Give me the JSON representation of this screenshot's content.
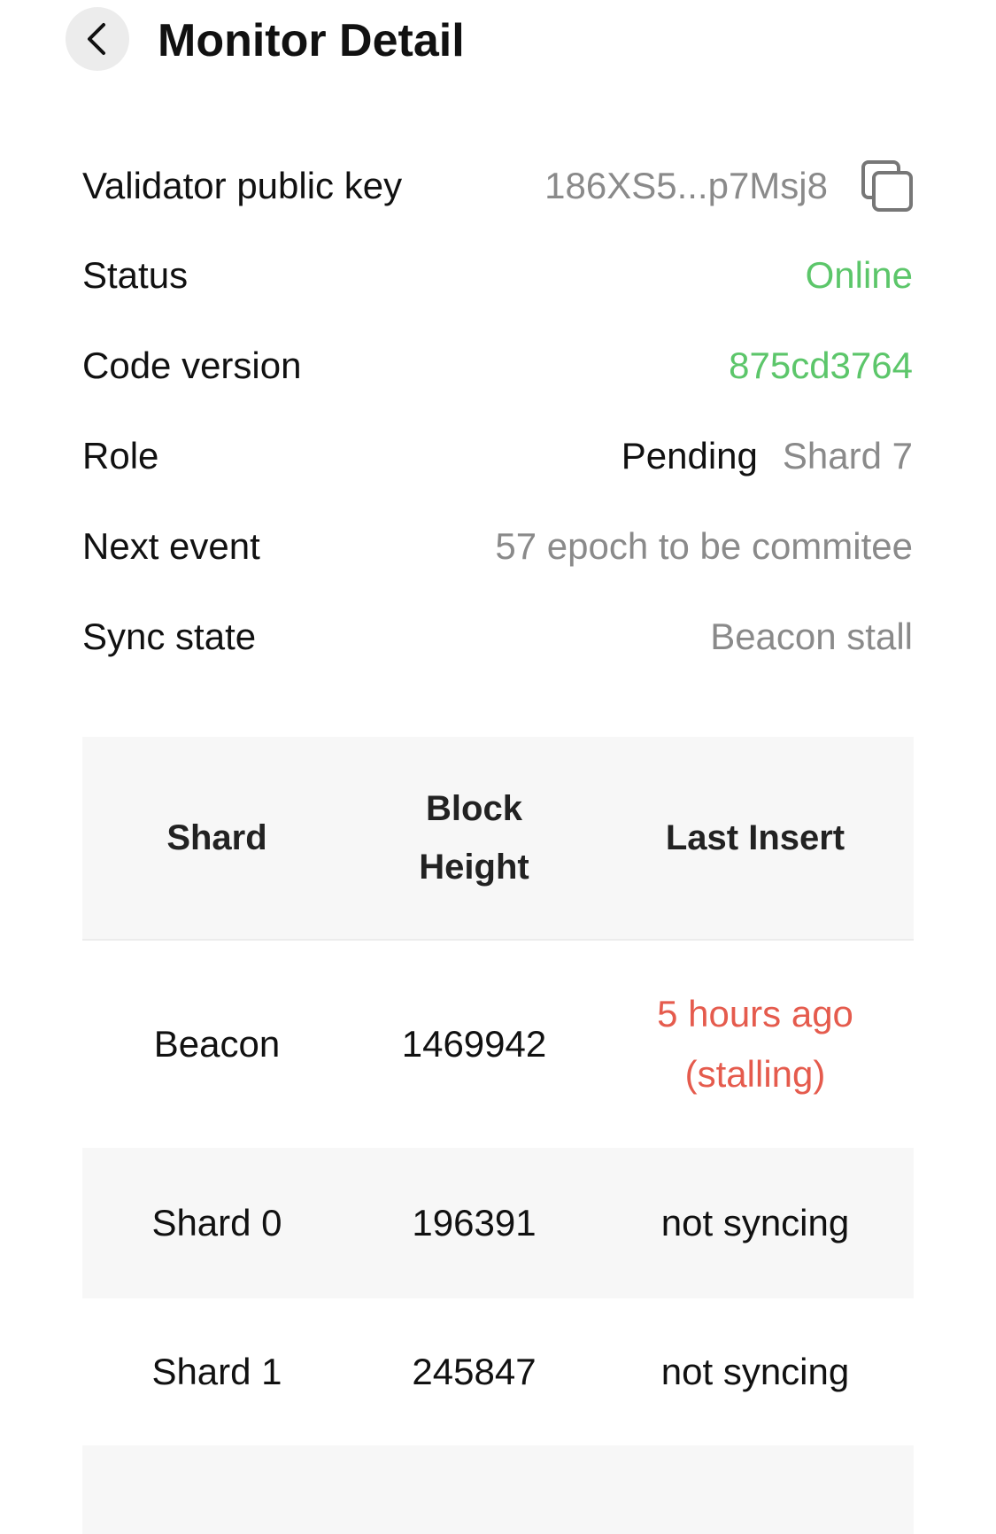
{
  "header": {
    "title": "Monitor Detail"
  },
  "info": {
    "public_key_label": "Validator public key",
    "public_key_value": "186XS5...p7Msj8",
    "status_label": "Status",
    "status_value": "Online",
    "code_version_label": "Code version",
    "code_version_value": "875cd3764",
    "role_label": "Role",
    "role_value": "Pending",
    "role_shard": "Shard 7",
    "next_event_label": "Next event",
    "next_event_value": "57 epoch to be commitee",
    "sync_state_label": "Sync state",
    "sync_state_value": "Beacon stall"
  },
  "table": {
    "headers": [
      "Shard",
      "Block Height",
      "Last Insert"
    ],
    "rows": [
      {
        "shard": "Beacon",
        "height": "1469942",
        "last_insert": "5 hours ago (stalling)"
      },
      {
        "shard": "Shard 0",
        "height": "196391",
        "last_insert": "not syncing"
      },
      {
        "shard": "Shard 1",
        "height": "245847",
        "last_insert": "not syncing"
      }
    ]
  },
  "colors": {
    "online": "#5cc66a",
    "stalling": "#e55b4d",
    "muted": "#8a8a8a"
  },
  "icons": {
    "back": "chevron-left-icon",
    "copy": "copy-icon"
  }
}
